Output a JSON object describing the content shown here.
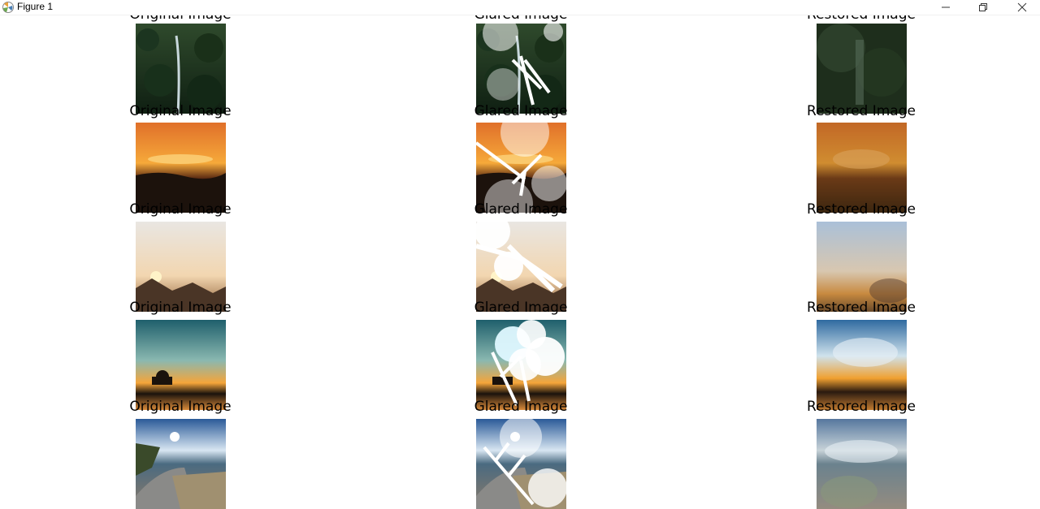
{
  "window": {
    "title": "Figure 1",
    "app_icon": "matplotlib-icon",
    "controls": [
      "minimize-icon",
      "restore-icon",
      "close-icon"
    ]
  },
  "figure": {
    "columns": [
      "Original Image",
      "Glared Image",
      "Restored Image"
    ],
    "rows": [
      {
        "scene": "forest-waterfall",
        "labels": [
          "Original Image",
          "Glared Image",
          "Restored Image"
        ]
      },
      {
        "scene": "orange-sunset",
        "labels": [
          "Original Image",
          "Glared Image",
          "Restored Image"
        ]
      },
      {
        "scene": "mountain-sunrise",
        "labels": [
          "Original Image",
          "Glared Image",
          "Restored Image"
        ]
      },
      {
        "scene": "lake-sunset",
        "labels": [
          "Original Image",
          "Glared Image",
          "Restored Image"
        ]
      },
      {
        "scene": "coastal-road",
        "labels": [
          "Original Image",
          "Glared Image",
          "Restored Image"
        ]
      }
    ]
  }
}
